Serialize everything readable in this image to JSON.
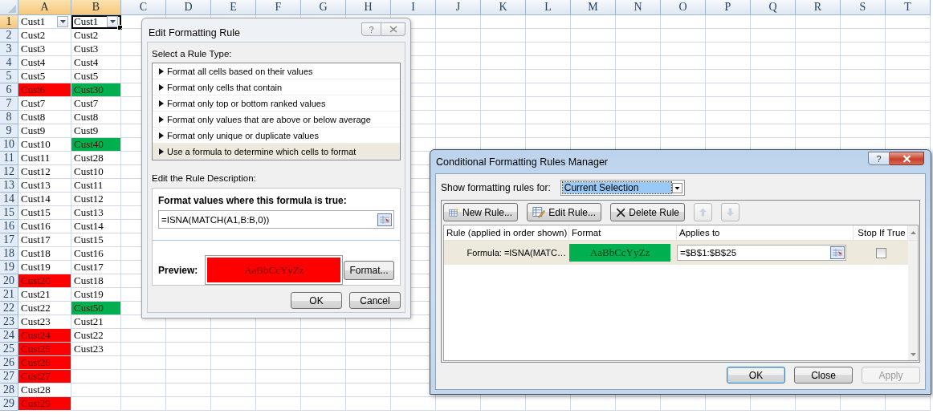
{
  "sheet": {
    "columns": [
      {
        "label": "A",
        "selected": true
      },
      {
        "label": "B",
        "selected": true
      },
      {
        "label": "C",
        "selected": false
      },
      {
        "label": "D",
        "selected": false
      },
      {
        "label": "E",
        "selected": false
      },
      {
        "label": "F",
        "selected": false
      },
      {
        "label": "G",
        "selected": false
      },
      {
        "label": "H",
        "selected": false
      },
      {
        "label": "I",
        "selected": false
      },
      {
        "label": "J",
        "selected": false
      },
      {
        "label": "K",
        "selected": false
      },
      {
        "label": "L",
        "selected": false
      },
      {
        "label": "M",
        "selected": false
      },
      {
        "label": "N",
        "selected": false
      },
      {
        "label": "O",
        "selected": false
      },
      {
        "label": "P",
        "selected": false
      },
      {
        "label": "Q",
        "selected": false
      },
      {
        "label": "R",
        "selected": false
      },
      {
        "label": "S",
        "selected": false
      },
      {
        "label": "T",
        "selected": false
      }
    ],
    "rows": [
      {
        "number": "1",
        "selected": true,
        "cells": [
          {
            "text": "Cust1",
            "filter": true,
            "active": false
          },
          {
            "text": "Cust1",
            "filter": true,
            "active": true
          }
        ]
      },
      {
        "number": "2",
        "selected": false,
        "cells": [
          {
            "text": "Cust2",
            "filter": false,
            "active": false
          },
          {
            "text": "Cust2",
            "filter": false,
            "active": false
          }
        ]
      },
      {
        "number": "3",
        "selected": false,
        "cells": [
          {
            "text": "Cust3",
            "filter": false,
            "active": false
          },
          {
            "text": "Cust3",
            "filter": false,
            "active": false
          }
        ]
      },
      {
        "number": "4",
        "selected": false,
        "cells": [
          {
            "text": "Cust4",
            "filter": false,
            "active": false
          },
          {
            "text": "Cust4",
            "filter": false,
            "active": false
          }
        ]
      },
      {
        "number": "5",
        "selected": false,
        "cells": [
          {
            "text": "Cust5",
            "filter": false,
            "active": false
          },
          {
            "text": "Cust5",
            "filter": false,
            "active": false
          }
        ]
      },
      {
        "number": "6",
        "selected": false,
        "cells": [
          {
            "text": "Cust6",
            "filter": false,
            "active": false,
            "color": "#ff0000"
          },
          {
            "text": "Cust30",
            "filter": false,
            "active": false,
            "color": "#00b050"
          }
        ]
      },
      {
        "number": "7",
        "selected": false,
        "cells": [
          {
            "text": "Cust7",
            "filter": false,
            "active": false
          },
          {
            "text": "Cust7",
            "filter": false,
            "active": false
          }
        ]
      },
      {
        "number": "8",
        "selected": false,
        "cells": [
          {
            "text": "Cust8",
            "filter": false,
            "active": false
          },
          {
            "text": "Cust8",
            "filter": false,
            "active": false
          }
        ]
      },
      {
        "number": "9",
        "selected": false,
        "cells": [
          {
            "text": "Cust9",
            "filter": false,
            "active": false
          },
          {
            "text": "Cust9",
            "filter": false,
            "active": false
          }
        ]
      },
      {
        "number": "10",
        "selected": false,
        "cells": [
          {
            "text": "Cust10",
            "filter": false,
            "active": false
          },
          {
            "text": "Cust40",
            "filter": false,
            "active": false,
            "color": "#00b050"
          }
        ]
      },
      {
        "number": "11",
        "selected": false,
        "cells": [
          {
            "text": "Cust11",
            "filter": false,
            "active": false
          },
          {
            "text": "Cust28",
            "filter": false,
            "active": false
          }
        ]
      },
      {
        "number": "12",
        "selected": false,
        "cells": [
          {
            "text": "Cust12",
            "filter": false,
            "active": false
          },
          {
            "text": "Cust10",
            "filter": false,
            "active": false
          }
        ]
      },
      {
        "number": "13",
        "selected": false,
        "cells": [
          {
            "text": "Cust13",
            "filter": false,
            "active": false
          },
          {
            "text": "Cust11",
            "filter": false,
            "active": false
          }
        ]
      },
      {
        "number": "14",
        "selected": false,
        "cells": [
          {
            "text": "Cust14",
            "filter": false,
            "active": false
          },
          {
            "text": "Cust12",
            "filter": false,
            "active": false
          }
        ]
      },
      {
        "number": "15",
        "selected": false,
        "cells": [
          {
            "text": "Cust15",
            "filter": false,
            "active": false
          },
          {
            "text": "Cust13",
            "filter": false,
            "active": false
          }
        ]
      },
      {
        "number": "16",
        "selected": false,
        "cells": [
          {
            "text": "Cust16",
            "filter": false,
            "active": false
          },
          {
            "text": "Cust14",
            "filter": false,
            "active": false
          }
        ]
      },
      {
        "number": "17",
        "selected": false,
        "cells": [
          {
            "text": "Cust17",
            "filter": false,
            "active": false
          },
          {
            "text": "Cust15",
            "filter": false,
            "active": false
          }
        ]
      },
      {
        "number": "18",
        "selected": false,
        "cells": [
          {
            "text": "Cust18",
            "filter": false,
            "active": false
          },
          {
            "text": "Cust16",
            "filter": false,
            "active": false
          }
        ]
      },
      {
        "number": "19",
        "selected": false,
        "cells": [
          {
            "text": "Cust19",
            "filter": false,
            "active": false
          },
          {
            "text": "Cust17",
            "filter": false,
            "active": false
          }
        ]
      },
      {
        "number": "20",
        "selected": false,
        "cells": [
          {
            "text": "Cust20",
            "filter": false,
            "active": false,
            "color": "#ff0000"
          },
          {
            "text": "Cust18",
            "filter": false,
            "active": false
          }
        ]
      },
      {
        "number": "21",
        "selected": false,
        "cells": [
          {
            "text": "Cust21",
            "filter": false,
            "active": false
          },
          {
            "text": "Cust19",
            "filter": false,
            "active": false
          }
        ]
      },
      {
        "number": "22",
        "selected": false,
        "cells": [
          {
            "text": "Cust22",
            "filter": false,
            "active": false
          },
          {
            "text": "Cust50",
            "filter": false,
            "active": false,
            "color": "#00b050"
          }
        ]
      },
      {
        "number": "23",
        "selected": false,
        "cells": [
          {
            "text": "Cust23",
            "filter": false,
            "active": false
          },
          {
            "text": "Cust21",
            "filter": false,
            "active": false
          }
        ]
      },
      {
        "number": "24",
        "selected": false,
        "cells": [
          {
            "text": "Cust24",
            "filter": false,
            "active": false,
            "color": "#ff0000"
          },
          {
            "text": "Cust22",
            "filter": false,
            "active": false
          }
        ]
      },
      {
        "number": "25",
        "selected": false,
        "cells": [
          {
            "text": "Cust25",
            "filter": false,
            "active": false,
            "color": "#ff0000"
          },
          {
            "text": "Cust23",
            "filter": false,
            "active": false
          }
        ]
      },
      {
        "number": "26",
        "selected": false,
        "cells": [
          {
            "text": "Cust26",
            "filter": false,
            "active": false,
            "color": "#ff0000"
          }
        ]
      },
      {
        "number": "27",
        "selected": false,
        "cells": [
          {
            "text": "Cust27",
            "filter": false,
            "active": false,
            "color": "#ff0000"
          }
        ]
      },
      {
        "number": "28",
        "selected": false,
        "cells": [
          {
            "text": "Cust28",
            "filter": false,
            "active": false
          }
        ]
      },
      {
        "number": "29",
        "selected": false,
        "cells": [
          {
            "text": "Cust29",
            "filter": false,
            "active": false,
            "color": "#ff0000"
          }
        ]
      }
    ]
  },
  "edit_rule_dialog": {
    "title": "Edit Formatting Rule",
    "help_button": "?",
    "rule_type_label": "Select a Rule Type:",
    "rule_types": [
      {
        "label": "Format all cells based on their values",
        "selected": false
      },
      {
        "label": "Format only cells that contain",
        "selected": false
      },
      {
        "label": "Format only top or bottom ranked values",
        "selected": false
      },
      {
        "label": "Format only values that are above or below average",
        "selected": false
      },
      {
        "label": "Format only unique or duplicate values",
        "selected": false
      },
      {
        "label": "Use a formula to determine which cells to format",
        "selected": true
      }
    ],
    "description_label": "Edit the Rule Description:",
    "formula_label": "Format values where this formula is true:",
    "formula_value": "=ISNA(MATCH(A1,B:B,0))",
    "preview_label": "Preview:",
    "preview_sample": {
      "text": "AaBbCcYyZz",
      "color": "#ff0000"
    },
    "format_button": "Format...",
    "buttons": [
      "OK",
      "Cancel"
    ]
  },
  "rules_manager_dialog": {
    "title": "Conditional Formatting Rules Manager",
    "help_button": "?",
    "show_rules_label": "Show formatting rules for:",
    "show_rules_value": "Current Selection",
    "toolbar": [
      {
        "kind": "new",
        "label": "New Rule...",
        "disabled": false
      },
      {
        "kind": "edit",
        "label": "Edit Rule...",
        "disabled": false
      },
      {
        "kind": "delete",
        "label": "Delete Rule",
        "disabled": false
      },
      {
        "kind": "up",
        "disabled": true
      },
      {
        "kind": "down",
        "disabled": true
      }
    ],
    "columns": [
      "Rule (applied in order shown)",
      "Format",
      "Applies to",
      "Stop If True"
    ],
    "rules": [
      {
        "rule": "Formula: =ISNA(MATC…",
        "format_sample": "AaBbCcYyZz",
        "color": "#00b050",
        "applies_to": "=$B$1:$B$25",
        "stop_if_true": false,
        "selected": true
      }
    ],
    "buttons": [
      {
        "label": "OK",
        "default": true,
        "disabled": false
      },
      {
        "label": "Close",
        "default": false,
        "disabled": false
      },
      {
        "label": "Apply",
        "default": false,
        "disabled": true
      }
    ]
  }
}
